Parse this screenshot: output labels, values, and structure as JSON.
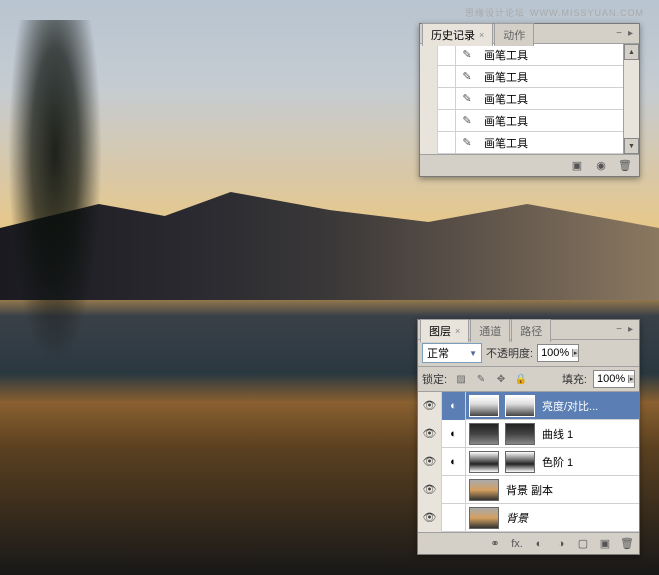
{
  "watermark": {
    "text": "思缘设计论坛",
    "url": "WWW.MISSYUAN.COM"
  },
  "history": {
    "tabs": [
      {
        "label": "历史记录",
        "active": true
      },
      {
        "label": "动作",
        "active": false
      }
    ],
    "items": [
      {
        "label": "画笔工具"
      },
      {
        "label": "画笔工具"
      },
      {
        "label": "画笔工具"
      },
      {
        "label": "画笔工具"
      },
      {
        "label": "画笔工具"
      }
    ]
  },
  "layers": {
    "tabs": [
      {
        "label": "图层",
        "active": true
      },
      {
        "label": "通道",
        "active": false
      },
      {
        "label": "路径",
        "active": false
      }
    ],
    "blend_mode": "正常",
    "opacity_label": "不透明度:",
    "opacity_value": "100%",
    "lock_label": "锁定:",
    "fill_label": "填充:",
    "fill_value": "100%",
    "items": [
      {
        "name": "亮度/对比...",
        "thumb": "bright",
        "selected": true,
        "hasLink": true,
        "hasMask": true
      },
      {
        "name": "曲线 1",
        "thumb": "curve",
        "selected": false,
        "hasLink": true,
        "hasMask": true
      },
      {
        "name": "色阶 1",
        "thumb": "levels",
        "selected": false,
        "hasLink": true,
        "hasMask": true
      },
      {
        "name": "背景 副本",
        "thumb": "photo",
        "selected": false,
        "hasLink": false,
        "hasMask": false
      },
      {
        "name": "背景",
        "thumb": "photo",
        "selected": false,
        "hasLink": false,
        "hasMask": false,
        "italic": true
      }
    ]
  }
}
